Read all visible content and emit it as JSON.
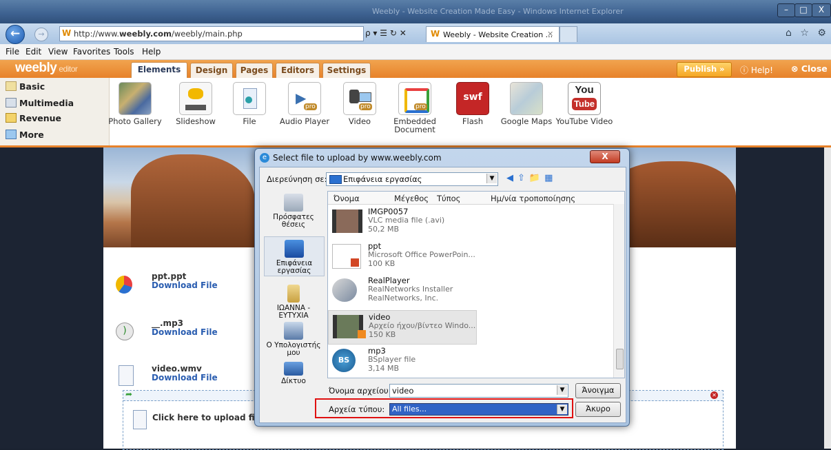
{
  "browser": {
    "window_title": "Weebly - Website Creation Made Easy - Windows Internet Explorer",
    "url_prefix": "http://www.",
    "url_bold": "weebly.com",
    "url_suffix": "/weebly/main.php",
    "address_controls": "ρ ▾ ☰ ↻ ✕",
    "tab_label": "Weebly - Website Creation ...",
    "tab_close": "✕",
    "nav_icons": "⌂ ☆ ⚙",
    "win_min": "–",
    "win_max": "□",
    "win_close": "X",
    "menu": [
      "File",
      "Edit",
      "View",
      "Favorites",
      "Tools",
      "Help"
    ]
  },
  "weebly": {
    "logo": "weebly",
    "logo_sub": "editor",
    "tabs": [
      "Elements",
      "Design",
      "Pages",
      "Editors",
      "Settings"
    ],
    "active_tab": "Elements",
    "publish": "Publish »",
    "help": "ⓘ Help!",
    "close": "⊗ Close",
    "sidebar": [
      "Basic",
      "Multimedia",
      "Revenue",
      "More"
    ],
    "elements": [
      "Photo Gallery",
      "Slideshow",
      "File",
      "Audio Player",
      "Video",
      "Embedded Document",
      "Flash",
      "Google Maps",
      "YouTube Video"
    ],
    "icon_flash": "swf",
    "icon_youtube_1": "You",
    "icon_youtube_2": "Tube",
    "icon_pro": "pro"
  },
  "page": {
    "files": [
      {
        "name": "ppt.ppt",
        "link": "Download File"
      },
      {
        "name": "__.mp3",
        "link": "Download File"
      },
      {
        "name": "video.wmv",
        "link": "Download File"
      }
    ],
    "upload_text": "Click here to upload file"
  },
  "dialog": {
    "title": "Select file to upload by www.weebly.com",
    "close": "X",
    "look_in_label": "Διερεύνηση σε:",
    "look_in_value": "Επιφάνεια εργασίας",
    "places": [
      "Πρόσφατες θέσεις",
      "Επιφάνεια εργασίας",
      "ΙΩΑΝΝΑ - ΕΥΤΥΧΙΑ",
      "Ο Υπολογιστής μου",
      "Δίκτυο"
    ],
    "columns": [
      "Όνομα",
      "Μέγεθος",
      "Τύπος",
      "Ημ/νία τροποποίησης"
    ],
    "files": [
      {
        "name": "IMGP0057",
        "type": "VLC media file (.avi)",
        "size": "50,2 MB"
      },
      {
        "name": "ppt",
        "type": "Microsoft Office PowerPoin...",
        "size": "100 KB"
      },
      {
        "name": "RealPlayer",
        "type": "RealNetworks Installer",
        "size": "RealNetworks, Inc."
      },
      {
        "name": "video",
        "type": "Αρχείο ήχου/βίντεο Windo...",
        "size": "150 KB"
      },
      {
        "name": "mp3",
        "type": "BSplayer file",
        "size": "3,14 MB"
      }
    ],
    "icon_bs": "BS",
    "filename_label": "Όνομα αρχείου:",
    "filename_value": "video",
    "filetype_label": "Αρχεία τύπου:",
    "filetype_value": "All files...",
    "open": "Άνοιγμα",
    "cancel": "Άκυρο",
    "dropdown_arrow": "▼"
  }
}
